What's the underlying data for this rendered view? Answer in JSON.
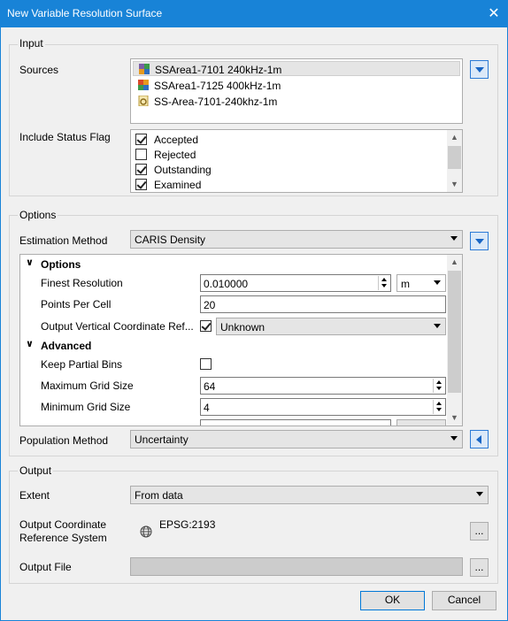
{
  "window": {
    "title": "New Variable Resolution Surface",
    "close_glyph": "✕"
  },
  "input": {
    "group_title": "Input",
    "sources_label": "Sources",
    "sources": [
      {
        "label": "SSArea1-7101 240kHz-1m",
        "icon": "grid-icon",
        "selected": true
      },
      {
        "label": "SSArea1-7125 400kHz-1m",
        "icon": "grid-icon",
        "selected": false
      },
      {
        "label": "SS-Area-7101-240khz-1m",
        "icon": "gear-file-icon",
        "selected": false
      }
    ],
    "status_label": "Include Status Flag",
    "status_flags": [
      {
        "label": "Accepted",
        "checked": true
      },
      {
        "label": "Rejected",
        "checked": false
      },
      {
        "label": "Outstanding",
        "checked": true
      },
      {
        "label": "Examined",
        "checked": true
      }
    ]
  },
  "options": {
    "group_title": "Options",
    "estimation_label": "Estimation Method",
    "estimation_value": "CARIS Density",
    "props": {
      "options_header": "Options",
      "finest_resolution_label": "Finest Resolution",
      "finest_resolution_value": "0.010000",
      "finest_resolution_unit": "m",
      "points_per_cell_label": "Points Per Cell",
      "points_per_cell_value": "20",
      "output_vcrs_label": "Output Vertical Coordinate Ref...",
      "output_vcrs_checked": true,
      "output_vcrs_value": "Unknown",
      "advanced_header": "Advanced",
      "keep_partial_label": "Keep Partial Bins",
      "keep_partial_checked": false,
      "max_grid_label": "Maximum Grid Size",
      "max_grid_value": "64",
      "min_grid_label": "Minimum Grid Size",
      "min_grid_value": "4"
    },
    "population_label": "Population Method",
    "population_value": "Uncertainty"
  },
  "output": {
    "group_title": "Output",
    "extent_label": "Extent",
    "extent_value": "From data",
    "crs_label_line1": "Output Coordinate",
    "crs_label_line2": "Reference System",
    "crs_value": "EPSG:2193",
    "browse_label": "...",
    "file_label": "Output File",
    "file_value": ""
  },
  "buttons": {
    "ok": "OK",
    "cancel": "Cancel"
  },
  "colors": {
    "titlebar": "#1883d7",
    "accent": "#2c7bd6",
    "selection": "#e5e5e5"
  }
}
